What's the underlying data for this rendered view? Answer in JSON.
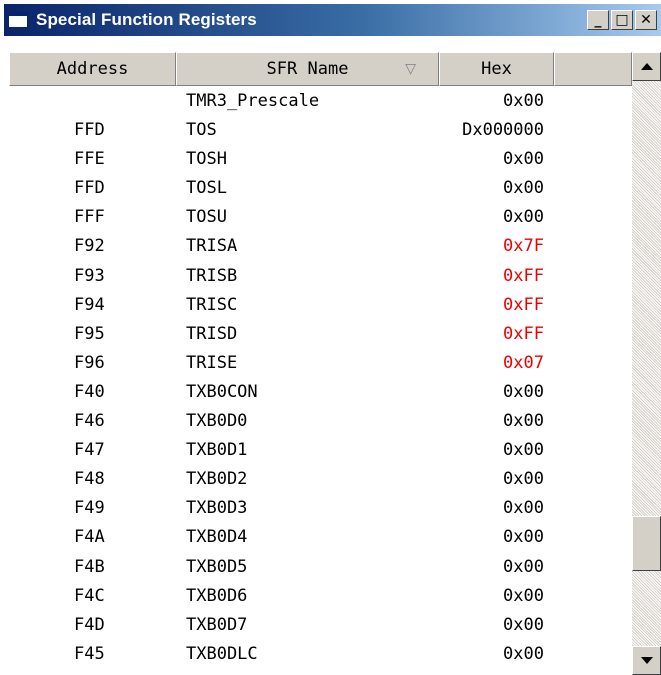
{
  "window": {
    "title": "Special Function Registers",
    "controls": {
      "minimize": "_",
      "maximize": "□",
      "close": "✕"
    }
  },
  "columns": {
    "address": "Address",
    "name": "SFR Name",
    "hex": "Hex",
    "sort_indicator": "▽"
  },
  "colors": {
    "title_gradient_start": "#0a246a",
    "title_gradient_end": "#a6caf0",
    "changed_value": "#ee0000"
  },
  "rows": [
    {
      "address": "",
      "name": "TMR3_Prescale",
      "hex": "0x00",
      "changed": false
    },
    {
      "address": "FFD",
      "name": "TOS",
      "hex": "Dx000000",
      "changed": false
    },
    {
      "address": "FFE",
      "name": "TOSH",
      "hex": "0x00",
      "changed": false
    },
    {
      "address": "FFD",
      "name": "TOSL",
      "hex": "0x00",
      "changed": false
    },
    {
      "address": "FFF",
      "name": "TOSU",
      "hex": "0x00",
      "changed": false
    },
    {
      "address": "F92",
      "name": "TRISA",
      "hex": "0x7F",
      "changed": true
    },
    {
      "address": "F93",
      "name": "TRISB",
      "hex": "0xFF",
      "changed": true
    },
    {
      "address": "F94",
      "name": "TRISC",
      "hex": "0xFF",
      "changed": true
    },
    {
      "address": "F95",
      "name": "TRISD",
      "hex": "0xFF",
      "changed": true
    },
    {
      "address": "F96",
      "name": "TRISE",
      "hex": "0x07",
      "changed": true
    },
    {
      "address": "F40",
      "name": "TXB0CON",
      "hex": "0x00",
      "changed": false
    },
    {
      "address": "F46",
      "name": "TXB0D0",
      "hex": "0x00",
      "changed": false
    },
    {
      "address": "F47",
      "name": "TXB0D1",
      "hex": "0x00",
      "changed": false
    },
    {
      "address": "F48",
      "name": "TXB0D2",
      "hex": "0x00",
      "changed": false
    },
    {
      "address": "F49",
      "name": "TXB0D3",
      "hex": "0x00",
      "changed": false
    },
    {
      "address": "F4A",
      "name": "TXB0D4",
      "hex": "0x00",
      "changed": false
    },
    {
      "address": "F4B",
      "name": "TXB0D5",
      "hex": "0x00",
      "changed": false
    },
    {
      "address": "F4C",
      "name": "TXB0D6",
      "hex": "0x00",
      "changed": false
    },
    {
      "address": "F4D",
      "name": "TXB0D7",
      "hex": "0x00",
      "changed": false
    },
    {
      "address": "F45",
      "name": "TXB0DLC",
      "hex": "0x00",
      "changed": false
    }
  ]
}
